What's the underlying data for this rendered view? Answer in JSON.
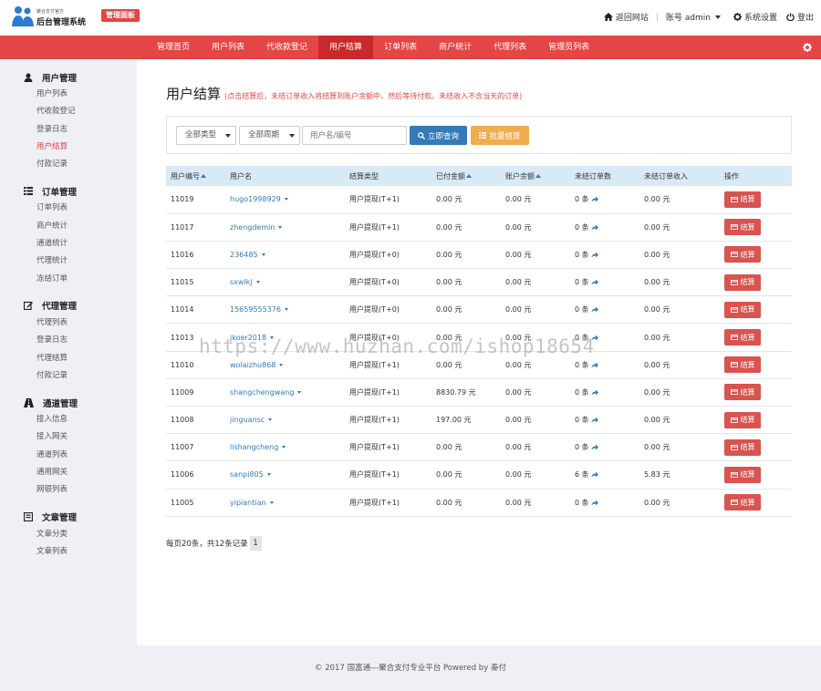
{
  "header": {
    "logo_small": "聚合支付官方",
    "logo_main": "后台管理系统",
    "panel_badge": "管理面板",
    "back_site": "返回网站",
    "account": "账号 admin",
    "settings": "系统设置",
    "logout": "登出"
  },
  "nav": {
    "items": [
      "管理首页",
      "用户列表",
      "代收款登记",
      "用户结算",
      "订单列表",
      "商户统计",
      "代理列表",
      "管理员列表"
    ],
    "active_index": 3
  },
  "sidebar": {
    "groups": [
      {
        "title": "用户管理",
        "icon": "user-icon",
        "links": [
          "用户列表",
          "代收款登记",
          "登录日志",
          "用户结算",
          "付款记录"
        ]
      },
      {
        "title": "订单管理",
        "icon": "list-icon",
        "links": [
          "订单列表",
          "商户统计",
          "通道统计",
          "代理统计",
          "冻结订单"
        ]
      },
      {
        "title": "代理管理",
        "icon": "edit-icon",
        "links": [
          "代理列表",
          "登录日志",
          "代理结算",
          "付款记录"
        ]
      },
      {
        "title": "通道管理",
        "icon": "road-icon",
        "links": [
          "接入信息",
          "接入网关",
          "通道列表",
          "通用网关",
          "网银列表"
        ]
      },
      {
        "title": "文章管理",
        "icon": "book-icon",
        "links": [
          "文章分类",
          "文章列表"
        ]
      }
    ],
    "active_link": "用户结算"
  },
  "page": {
    "title": "用户结算",
    "note": "(点击结算后，未结订单收入将结算到账户余额中，然后等待付款。未结收入不含当天的订单)"
  },
  "filters": {
    "type_select": "全部类型",
    "cycle_select": "全部周期",
    "search_placeholder": "用户名/编号",
    "query_button": "立即查询",
    "batch_button": "批量结算"
  },
  "table": {
    "headers": [
      "用户编号",
      "用户名",
      "结算类型",
      "已付金额",
      "账户余额",
      "未结订单数",
      "未结订单收入",
      "操作"
    ],
    "rows": [
      {
        "id": "11019",
        "name": "hugo1998929",
        "type": "用户提现(T+1)",
        "paid": "0.00 元",
        "balance": "0.00 元",
        "count": "0 条",
        "income": "0.00 元",
        "action": "结算"
      },
      {
        "id": "11017",
        "name": "zhengdemin",
        "type": "用户提现(T+1)",
        "paid": "0.00 元",
        "balance": "0.00 元",
        "count": "0 条",
        "income": "0.00 元",
        "action": "结算"
      },
      {
        "id": "11016",
        "name": "236485",
        "type": "用户提现(T+0)",
        "paid": "0.00 元",
        "balance": "0.00 元",
        "count": "0 条",
        "income": "0.00 元",
        "action": "结算"
      },
      {
        "id": "11015",
        "name": "sxwlkj",
        "type": "用户提现(T+0)",
        "paid": "0.00 元",
        "balance": "0.00 元",
        "count": "0 条",
        "income": "0.00 元",
        "action": "结算"
      },
      {
        "id": "11014",
        "name": "15659555376",
        "type": "用户提现(T+0)",
        "paid": "0.00 元",
        "balance": "0.00 元",
        "count": "0 条",
        "income": "0.00 元",
        "action": "结算"
      },
      {
        "id": "11013",
        "name": "jkoer2018",
        "type": "用户提现(T+0)",
        "paid": "0.00 元",
        "balance": "0.00 元",
        "count": "0 条",
        "income": "0.00 元",
        "action": "结算"
      },
      {
        "id": "11010",
        "name": "wolaizhu868",
        "type": "用户提现(T+1)",
        "paid": "0.00 元",
        "balance": "0.00 元",
        "count": "0 条",
        "income": "0.00 元",
        "action": "结算"
      },
      {
        "id": "11009",
        "name": "shangchengwang",
        "type": "用户提现(T+1)",
        "paid": "8830.79 元",
        "balance": "0.00 元",
        "count": "0 条",
        "income": "0.00 元",
        "action": "结算"
      },
      {
        "id": "11008",
        "name": "jinguansc",
        "type": "用户提现(T+1)",
        "paid": "197.00 元",
        "balance": "0.00 元",
        "count": "0 条",
        "income": "0.00 元",
        "action": "结算"
      },
      {
        "id": "11007",
        "name": "lishangcheng",
        "type": "用户提现(T+1)",
        "paid": "0.00 元",
        "balance": "0.00 元",
        "count": "0 条",
        "income": "0.00 元",
        "action": "结算"
      },
      {
        "id": "11006",
        "name": "sanpi805",
        "type": "用户提现(T+1)",
        "paid": "0.00 元",
        "balance": "0.00 元",
        "count": "6 条",
        "income": "5.83 元",
        "action": "结算"
      },
      {
        "id": "11005",
        "name": "yipiantian",
        "type": "用户提现(T+1)",
        "paid": "0.00 元",
        "balance": "0.00 元",
        "count": "0 条",
        "income": "0.00 元",
        "action": "结算"
      }
    ]
  },
  "pager": {
    "summary": "每页20条，共12条记录",
    "current_page": "1"
  },
  "watermark": "https://www.huzhan.com/ishop18654",
  "footer": "© 2017  国富通---聚合支付专业平台 Powered by 秦付",
  "colors": {
    "accent": "#e44545",
    "primary": "#337ab7",
    "warning": "#f0ad4e",
    "success": "#3ca84b"
  }
}
